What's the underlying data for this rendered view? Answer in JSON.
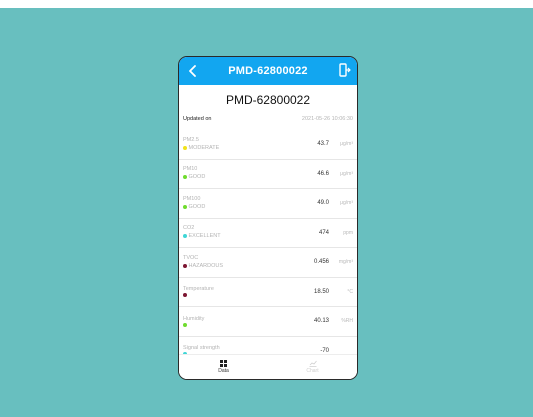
{
  "header": {
    "title": "PMD-62800022"
  },
  "device_name": "PMD-62800022",
  "updated": {
    "label": "Updated on",
    "timestamp": "2021-05-26 10:06:30"
  },
  "colors": {
    "appbar": "#12a6f0",
    "background": "#68bfbf",
    "status_moderate": "#f1e21a",
    "status_good": "#6fdc2e",
    "status_excellent": "#3fd6d6",
    "status_hazardous": "#7d1632"
  },
  "readings": [
    {
      "name": "PM2.5",
      "status": "MODERATE",
      "value": "43.7",
      "unit": "μg/m³",
      "dot_color": "#f1e21a"
    },
    {
      "name": "PM10",
      "status": "GOOD",
      "value": "46.6",
      "unit": "μg/m³",
      "dot_color": "#6fdc2e"
    },
    {
      "name": "PM100",
      "status": "GOOD",
      "value": "49.0",
      "unit": "μg/m³",
      "dot_color": "#6fdc2e"
    },
    {
      "name": "CO2",
      "status": "EXCELLENT",
      "value": "474",
      "unit": "ppm",
      "dot_color": "#3fd6d6"
    },
    {
      "name": "TVOC",
      "status": "HAZARDOUS",
      "value": "0.456",
      "unit": "mg/m³",
      "dot_color": "#7d1632"
    },
    {
      "name": "Temperature",
      "status": "",
      "value": "18.50",
      "unit": "°C",
      "dot_color": "#7d1632"
    },
    {
      "name": "Humidity",
      "status": "",
      "value": "40.13",
      "unit": "%RH",
      "dot_color": "#6fdc2e"
    },
    {
      "name": "Signal strength",
      "status": "",
      "value": "-70",
      "unit": "",
      "dot_color": "#3fd6d6"
    }
  ],
  "tabs": [
    {
      "label": "Data",
      "icon": "grid-icon",
      "active": true
    },
    {
      "label": "Chart",
      "icon": "chart-icon",
      "active": false
    }
  ]
}
